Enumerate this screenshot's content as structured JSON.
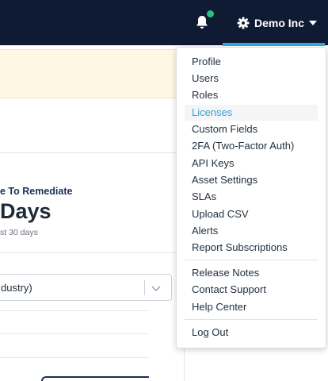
{
  "header": {
    "account_label": "Demo Inc",
    "accent_color": "#3aa8d8",
    "notification_dot_color": "#27c281",
    "icons": [
      "bell-icon",
      "gear-icon",
      "caret-down-icon",
      "chevron-down-icon"
    ]
  },
  "metric": {
    "title": "e To Remediate",
    "value": "Days",
    "subtitle": "st 30 days"
  },
  "filter": {
    "value": "dustry)"
  },
  "menu": {
    "items": [
      {
        "label": "Profile"
      },
      {
        "label": "Users"
      },
      {
        "label": "Roles"
      },
      {
        "label": "Licenses",
        "active": true
      },
      {
        "label": "Custom Fields"
      },
      {
        "label": "2FA (Two-Factor Auth)"
      },
      {
        "label": "API Keys"
      },
      {
        "label": "Asset Settings"
      },
      {
        "label": "SLAs"
      },
      {
        "label": "Upload CSV"
      },
      {
        "label": "Alerts"
      },
      {
        "label": "Report Subscriptions"
      },
      {
        "label": "Release Notes"
      },
      {
        "label": "Contact Support"
      },
      {
        "label": "Help Center"
      },
      {
        "label": "Log Out"
      }
    ]
  }
}
